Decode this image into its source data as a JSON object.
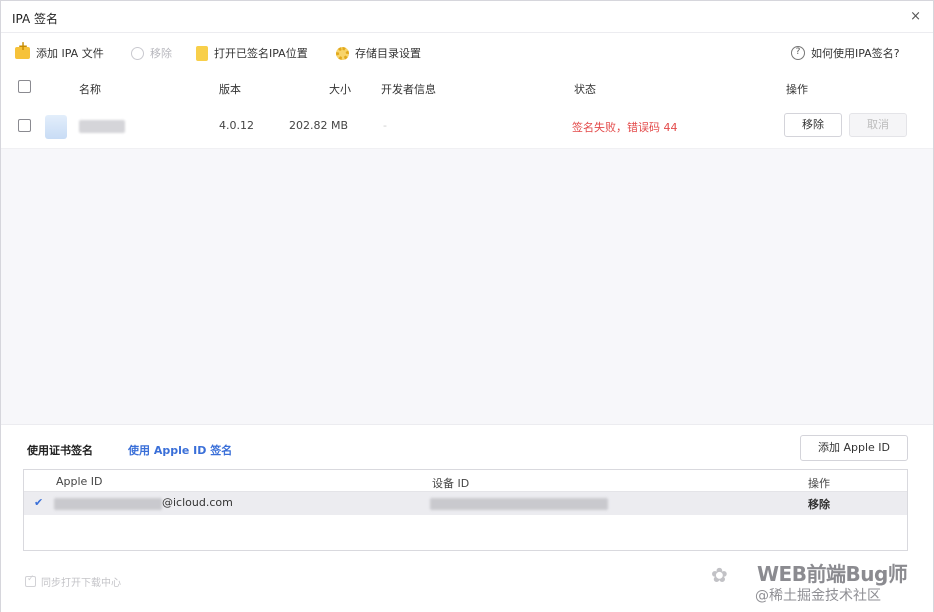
{
  "window": {
    "title": "IPA 签名",
    "close_label": "×"
  },
  "toolbar": {
    "add_ipa": "添加 IPA 文件",
    "remove": "移除",
    "open_location": "打开已签名IPA位置",
    "storage_settings": "存储目录设置",
    "help": "如何使用IPA签名?"
  },
  "table": {
    "headers": {
      "name": "名称",
      "version": "版本",
      "size": "大小",
      "developer": "开发者信息",
      "status": "状态",
      "actions": "操作"
    },
    "rows": [
      {
        "name": "",
        "version": "4.0.12",
        "size": "202.82 MB",
        "developer": "-",
        "status": "签名失败，错误码 44",
        "remove_label": "移除",
        "cancel_label": "取消"
      }
    ]
  },
  "signing": {
    "tab_certificate": "使用证书签名",
    "tab_apple_id": "使用 Apple ID 签名",
    "add_apple_id": "添加 Apple ID",
    "columns": {
      "apple_id": "Apple ID",
      "device_id": "设备 ID",
      "actions": "操作"
    },
    "rows": [
      {
        "selected": "✔",
        "apple_id_suffix": "@icloud.com",
        "action": "移除"
      }
    ],
    "open_download": "同步打开下载中心"
  },
  "watermark": {
    "title": "WEB前端Bug师",
    "subtitle": "@稀土掘金技术社区"
  },
  "colors": {
    "error": "#e34a4a",
    "link": "#3a6fd8",
    "folder": "#f6c23a"
  }
}
